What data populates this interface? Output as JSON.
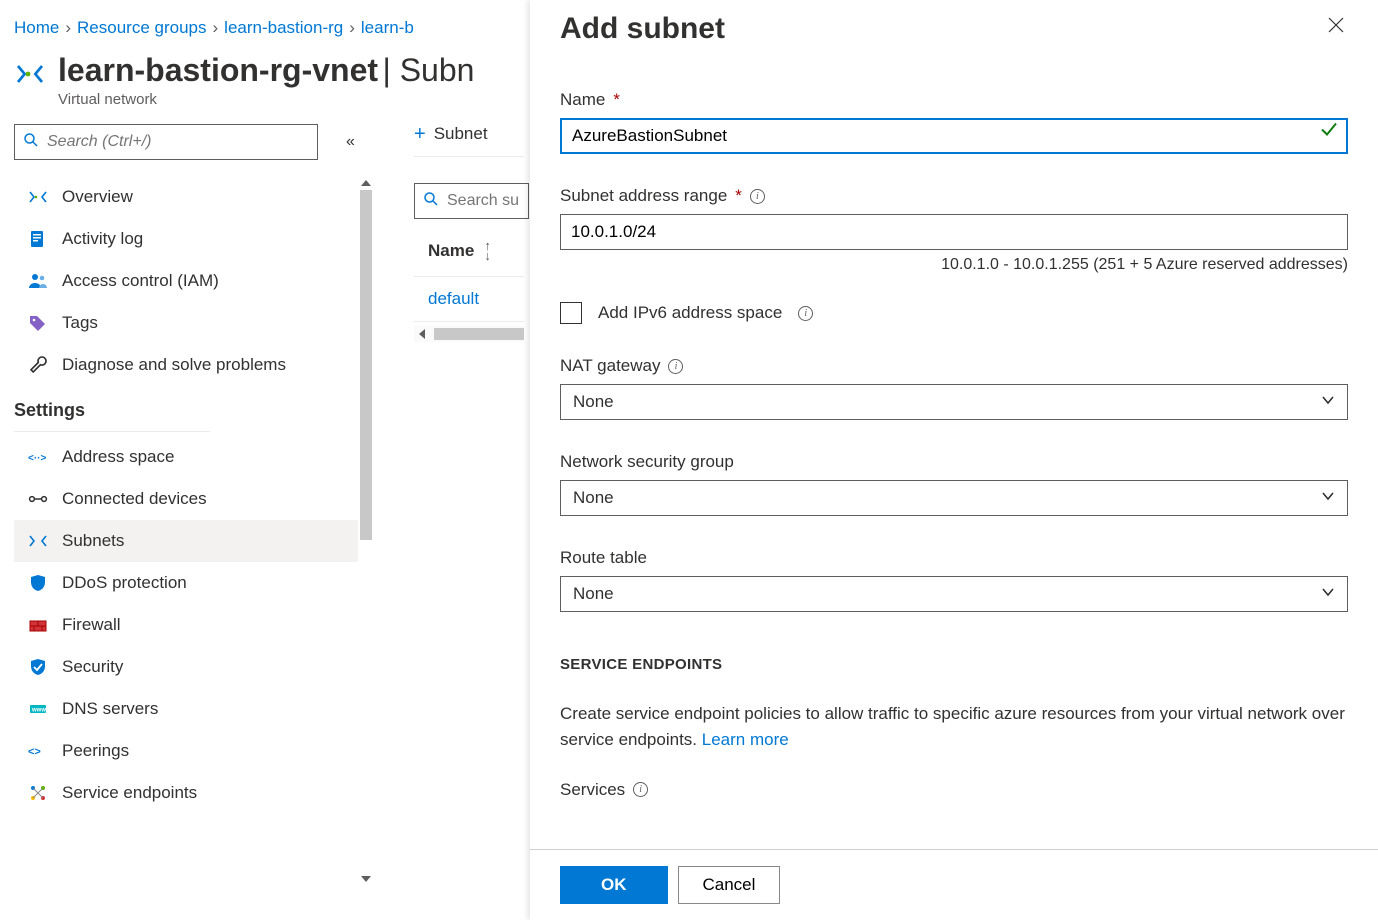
{
  "breadcrumb": {
    "home": "Home",
    "rg": "Resource groups",
    "rg_name": "learn-bastion-rg",
    "vnet": "learn-b"
  },
  "title": {
    "name": "learn-bastion-rg-vnet",
    "suffix": "Subn",
    "type": "Virtual network"
  },
  "nav": {
    "search_placeholder": "Search (Ctrl+/)",
    "items": [
      "Overview",
      "Activity log",
      "Access control (IAM)",
      "Tags",
      "Diagnose and solve problems"
    ],
    "section": "Settings",
    "settings_items": [
      "Address space",
      "Connected devices",
      "Subnets",
      "DDoS protection",
      "Firewall",
      "Security",
      "DNS servers",
      "Peerings",
      "Service endpoints"
    ]
  },
  "cmd": {
    "add_subnet": "Subnet",
    "search_placeholder": "Search su"
  },
  "table": {
    "header_name": "Name",
    "row0": "default"
  },
  "panel": {
    "title": "Add subnet",
    "name_label": "Name",
    "name_value": "AzureBastionSubnet",
    "range_label": "Subnet address range",
    "range_value": "10.0.1.0/24",
    "range_helper": "10.0.1.0 - 10.0.1.255 (251 + 5 Azure reserved addresses)",
    "ipv6_label": "Add IPv6 address space",
    "nat_label": "NAT gateway",
    "nat_value": "None",
    "nsg_label": "Network security group",
    "nsg_value": "None",
    "rt_label": "Route table",
    "rt_value": "None",
    "se_header": "SERVICE ENDPOINTS",
    "se_desc": "Create service endpoint policies to allow traffic to specific azure resources from your virtual network over service endpoints. ",
    "se_learn": "Learn more",
    "services_label": "Services",
    "ok": "OK",
    "cancel": "Cancel"
  }
}
